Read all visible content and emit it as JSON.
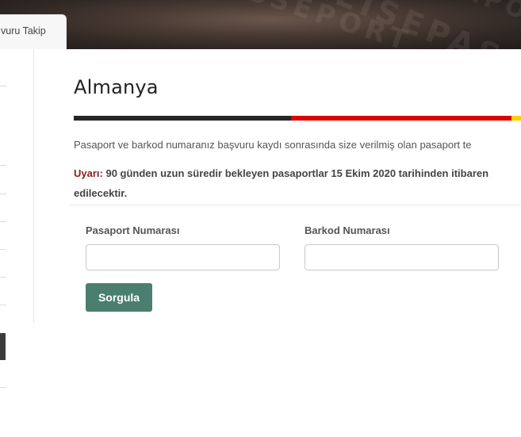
{
  "tab": {
    "label": "vuru Takip"
  },
  "page": {
    "title": "Almanya",
    "info_text": "Pasaport ve barkod numaranız başvuru kaydı sonrasında size verilmiş olan pasaport te",
    "warning_label": "Uyarı:",
    "warning_text": " 90 günden uzun süredir bekleyen pasaportlar 15 Ekim 2020 tarihinden itibaren edilecektir.",
    "flag_colors": [
      "#262626",
      "#dd0000",
      "#ffce00"
    ]
  },
  "form": {
    "passport_label": "Pasaport Numarası",
    "passport_value": "",
    "barcode_label": "Barkod Numarası",
    "barcode_value": "",
    "submit_label": "Sorgula",
    "submit_color": "#4a7f6f"
  }
}
